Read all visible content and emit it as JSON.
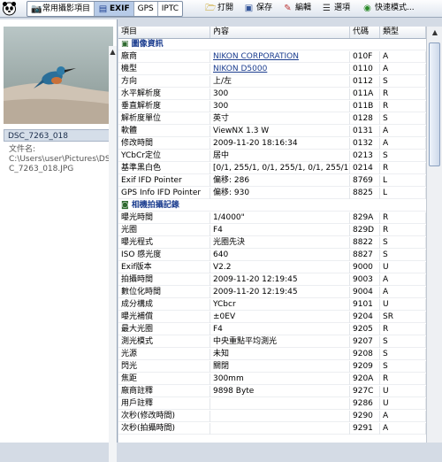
{
  "toolbar": {
    "tabs": [
      {
        "label": "常用攝影項目",
        "icon": "camera-icon"
      },
      {
        "label": "EXIF",
        "icon": "list-icon"
      },
      {
        "label": "GPS",
        "icon": ""
      },
      {
        "label": "IPTC",
        "icon": ""
      }
    ],
    "open_label": "打開",
    "save_label": "保存",
    "edit_label": "編輯",
    "options_label": "選項",
    "quick_label": "快速模式..."
  },
  "left_panel": {
    "file_name": "DSC_7263_018",
    "path_label": "文件名:",
    "path_value": "C:\\Users\\user\\Pictures\\DSC_7263_018.JPG"
  },
  "table": {
    "headers": [
      "項目",
      "內容",
      "代碼",
      "類型"
    ],
    "rows": [
      {
        "kind": "section",
        "label": "圖像資訊",
        "icon": "image-icon"
      },
      {
        "kind": "row",
        "item": "廠商",
        "value": "NIKON CORPORATION",
        "code": "010F",
        "type": "A",
        "link": true
      },
      {
        "kind": "row",
        "item": "機型",
        "value": "NIKON D5000",
        "code": "0110",
        "type": "A",
        "link": true
      },
      {
        "kind": "row",
        "item": "方向",
        "value": "上/左",
        "code": "0112",
        "type": "S"
      },
      {
        "kind": "row",
        "item": "水平解析度",
        "value": "300",
        "code": "011A",
        "type": "R"
      },
      {
        "kind": "row",
        "item": "垂直解析度",
        "value": "300",
        "code": "011B",
        "type": "R"
      },
      {
        "kind": "row",
        "item": "解析度單位",
        "value": "英寸",
        "code": "0128",
        "type": "S"
      },
      {
        "kind": "row",
        "item": "軟體",
        "value": "ViewNX 1.3 W",
        "code": "0131",
        "type": "A"
      },
      {
        "kind": "row",
        "item": "修改時間",
        "value": "2009-11-20 18:16:34",
        "code": "0132",
        "type": "A"
      },
      {
        "kind": "row",
        "item": "YCbCr定位",
        "value": "居中",
        "code": "0213",
        "type": "S"
      },
      {
        "kind": "row",
        "item": "基準黑白色",
        "value": "[0/1, 255/1, 0/1, 255/1, 0/1, 255/1]",
        "code": "0214",
        "type": "R"
      },
      {
        "kind": "row",
        "item": "Exif IFD Pointer",
        "value": "偏移: 286",
        "code": "8769",
        "type": "L"
      },
      {
        "kind": "row",
        "item": "GPS Info IFD Pointer",
        "value": "偏移: 930",
        "code": "8825",
        "type": "L"
      },
      {
        "kind": "section",
        "label": "相機拍攝記錄",
        "icon": "camera-icon"
      },
      {
        "kind": "row",
        "item": "曝光時間",
        "value": "1/4000\"",
        "code": "829A",
        "type": "R"
      },
      {
        "kind": "row",
        "item": "光圈",
        "value": "F4",
        "code": "829D",
        "type": "R"
      },
      {
        "kind": "row",
        "item": "曝光程式",
        "value": "光圈先決",
        "code": "8822",
        "type": "S"
      },
      {
        "kind": "row",
        "item": "ISO 感光度",
        "value": "640",
        "code": "8827",
        "type": "S"
      },
      {
        "kind": "row",
        "item": "Exif版本",
        "value": "V2.2",
        "code": "9000",
        "type": "U"
      },
      {
        "kind": "row",
        "item": "拍攝時間",
        "value": "2009-11-20 12:19:45",
        "code": "9003",
        "type": "A"
      },
      {
        "kind": "row",
        "item": "數位化時間",
        "value": "2009-11-20 12:19:45",
        "code": "9004",
        "type": "A"
      },
      {
        "kind": "row",
        "item": "成分構成",
        "value": "YCbcr",
        "code": "9101",
        "type": "U"
      },
      {
        "kind": "row",
        "item": "曝光補償",
        "value": "±0EV",
        "code": "9204",
        "type": "SR"
      },
      {
        "kind": "row",
        "item": "最大光圈",
        "value": "F4",
        "code": "9205",
        "type": "R"
      },
      {
        "kind": "row",
        "item": "測光模式",
        "value": "中央重點平均測光",
        "code": "9207",
        "type": "S"
      },
      {
        "kind": "row",
        "item": "光源",
        "value": "未知",
        "code": "9208",
        "type": "S"
      },
      {
        "kind": "row",
        "item": "閃光",
        "value": "關閉",
        "code": "9209",
        "type": "S"
      },
      {
        "kind": "row",
        "item": "焦距",
        "value": "300mm",
        "code": "920A",
        "type": "R"
      },
      {
        "kind": "row",
        "item": "廠商註釋",
        "value": "9898 Byte",
        "code": "927C",
        "type": "U"
      },
      {
        "kind": "row",
        "item": "用戶註釋",
        "value": "",
        "code": "9286",
        "type": "U"
      },
      {
        "kind": "row",
        "item": "次秒(修改時間)",
        "value": "",
        "code": "9290",
        "type": "A"
      },
      {
        "kind": "row",
        "item": "次秒(拍攝時間)",
        "value": "",
        "code": "9291",
        "type": "A"
      }
    ]
  },
  "colors": {
    "accent": "#1b3d8f",
    "active_tab": "#b7cbe8",
    "panel_bg": "#d4dbe5"
  }
}
